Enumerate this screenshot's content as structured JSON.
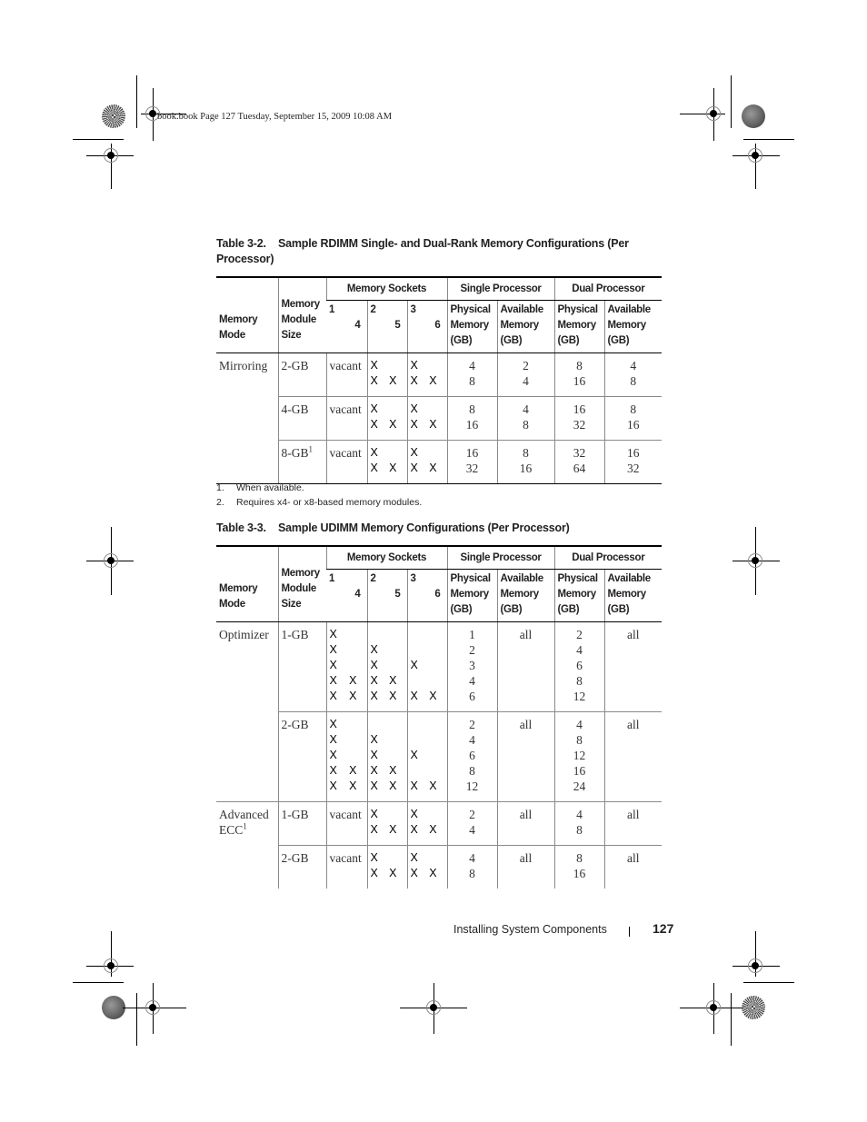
{
  "slug": "book.book  Page 127  Tuesday, September 15, 2009  10:08 AM",
  "table_3_2": {
    "number": "Table 3-2.",
    "title": "Sample RDIMM Single- and Dual-Rank Memory Configurations (Per Processor)",
    "headers": {
      "memory_mode": "Memory Mode",
      "module_size": "Memory Module Size",
      "memory_sockets": "Memory Sockets",
      "single_processor": "Single Processor",
      "dual_processor": "Dual Processor",
      "socket_pairs": [
        [
          "1",
          "4"
        ],
        [
          "2",
          "5"
        ],
        [
          "3",
          "6"
        ]
      ],
      "physical_memory": "Physical Memory (GB)",
      "available_memory": "Available Memory (GB)"
    },
    "rows": [
      {
        "mode": "Mirroring",
        "size": "2-GB",
        "size_sup": "",
        "s14": [
          [
            "vacant",
            ""
          ]
        ],
        "s25": [
          [
            "X",
            ""
          ],
          [
            "X",
            "X"
          ]
        ],
        "s36": [
          [
            "X",
            ""
          ],
          [
            "X",
            "X"
          ]
        ],
        "sp_phys": [
          "4",
          "8"
        ],
        "sp_avail": [
          "2",
          "4"
        ],
        "dp_phys": [
          "8",
          "16"
        ],
        "dp_avail": [
          "4",
          "8"
        ]
      },
      {
        "mode": "",
        "size": "4-GB",
        "size_sup": "",
        "s14": [
          [
            "vacant",
            ""
          ]
        ],
        "s25": [
          [
            "X",
            ""
          ],
          [
            "X",
            "X"
          ]
        ],
        "s36": [
          [
            "X",
            ""
          ],
          [
            "X",
            "X"
          ]
        ],
        "sp_phys": [
          "8",
          "16"
        ],
        "sp_avail": [
          "4",
          "8"
        ],
        "dp_phys": [
          "16",
          "32"
        ],
        "dp_avail": [
          "8",
          "16"
        ]
      },
      {
        "mode": "",
        "size": "8-GB",
        "size_sup": "1",
        "s14": [
          [
            "vacant",
            ""
          ]
        ],
        "s25": [
          [
            "X",
            ""
          ],
          [
            "X",
            "X"
          ]
        ],
        "s36": [
          [
            "X",
            ""
          ],
          [
            "X",
            "X"
          ]
        ],
        "sp_phys": [
          "16",
          "32"
        ],
        "sp_avail": [
          "8",
          "16"
        ],
        "dp_phys": [
          "32",
          "64"
        ],
        "dp_avail": [
          "16",
          "32"
        ]
      }
    ]
  },
  "footnotes": [
    {
      "num": "1.",
      "text": "When available."
    },
    {
      "num": "2.",
      "text": "Requires x4- or x8-based memory modules."
    }
  ],
  "table_3_3": {
    "number": "Table 3-3.",
    "title": "Sample UDIMM Memory Configurations (Per Processor)",
    "headers": {
      "memory_mode": "Memory Mode",
      "module_size": "Memory Module Size",
      "memory_sockets": "Memory Sockets",
      "single_processor": "Single Processor",
      "dual_processor": "Dual Processor",
      "socket_pairs": [
        [
          "1",
          "4"
        ],
        [
          "2",
          "5"
        ],
        [
          "3",
          "6"
        ]
      ],
      "physical_memory": "Physical Memory (GB)",
      "available_memory": "Available Memory (GB)"
    },
    "rows": [
      {
        "mode": "Optimizer",
        "mode_sup": "",
        "size": "1-GB",
        "s14": [
          [
            "X",
            ""
          ],
          [
            "X",
            ""
          ],
          [
            "X",
            ""
          ],
          [
            "X",
            "X"
          ],
          [
            "X",
            "X"
          ]
        ],
        "s25": [
          [
            "",
            ""
          ],
          [
            "X",
            ""
          ],
          [
            "X",
            ""
          ],
          [
            "X",
            "X"
          ],
          [
            "X",
            "X"
          ]
        ],
        "s36": [
          [
            "",
            ""
          ],
          [
            "",
            ""
          ],
          [
            "X",
            ""
          ],
          [
            "",
            ""
          ],
          [
            "X",
            "X"
          ]
        ],
        "sp_phys": [
          "1",
          "2",
          "3",
          "4",
          "6"
        ],
        "sp_avail": [
          "all"
        ],
        "dp_phys": [
          "2",
          "4",
          "6",
          "8",
          "12"
        ],
        "dp_avail": [
          "all"
        ]
      },
      {
        "mode": "",
        "mode_sup": "",
        "size": "2-GB",
        "s14": [
          [
            "X",
            ""
          ],
          [
            "X",
            ""
          ],
          [
            "X",
            ""
          ],
          [
            "X",
            "X"
          ],
          [
            "X",
            "X"
          ]
        ],
        "s25": [
          [
            "",
            ""
          ],
          [
            "X",
            ""
          ],
          [
            "X",
            ""
          ],
          [
            "X",
            "X"
          ],
          [
            "X",
            "X"
          ]
        ],
        "s36": [
          [
            "",
            ""
          ],
          [
            "",
            ""
          ],
          [
            "X",
            ""
          ],
          [
            "",
            ""
          ],
          [
            "X",
            "X"
          ]
        ],
        "sp_phys": [
          "2",
          "4",
          "6",
          "8",
          "12"
        ],
        "sp_avail": [
          "all"
        ],
        "dp_phys": [
          "4",
          "8",
          "12",
          "16",
          "24"
        ],
        "dp_avail": [
          "all"
        ]
      },
      {
        "mode": "Advanced ECC",
        "mode_sup": "1",
        "size": "1-GB",
        "s14": [
          [
            "vacant",
            ""
          ]
        ],
        "s25": [
          [
            "X",
            ""
          ],
          [
            "X",
            "X"
          ]
        ],
        "s36": [
          [
            "X",
            ""
          ],
          [
            "X",
            "X"
          ]
        ],
        "sp_phys": [
          "2",
          "4"
        ],
        "sp_avail": [
          "all"
        ],
        "dp_phys": [
          "4",
          "8"
        ],
        "dp_avail": [
          "all"
        ]
      },
      {
        "mode": "",
        "mode_sup": "",
        "size": "2-GB",
        "s14": [
          [
            "vacant",
            ""
          ]
        ],
        "s25": [
          [
            "X",
            ""
          ],
          [
            "X",
            "X"
          ]
        ],
        "s36": [
          [
            "X",
            ""
          ],
          [
            "X",
            "X"
          ]
        ],
        "sp_phys": [
          "4",
          "8"
        ],
        "sp_avail": [
          "all"
        ],
        "dp_phys": [
          "8",
          "16"
        ],
        "dp_avail": [
          "all"
        ]
      }
    ]
  },
  "footer": {
    "section": "Installing System Components",
    "page_number": "127"
  }
}
